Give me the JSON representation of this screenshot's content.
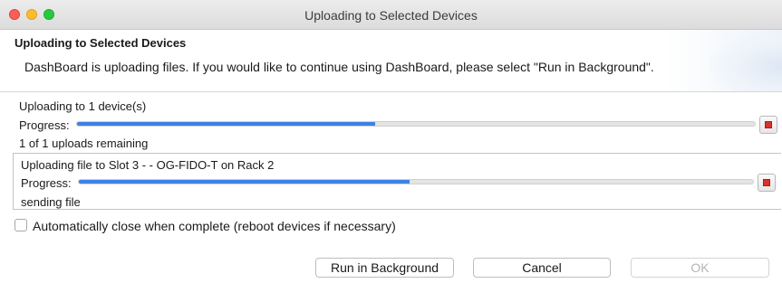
{
  "window": {
    "title": "Uploading to Selected Devices"
  },
  "header": {
    "title": "Uploading to Selected Devices",
    "description": "DashBoard is uploading files.  If you would like to continue using DashBoard, please select \"Run in Background\"."
  },
  "overall": {
    "status": "Uploading to 1 device(s)",
    "progress_label": "Progress:",
    "progress_fraction": 0.44,
    "remaining": "1 of 1 uploads remaining"
  },
  "detail": {
    "status": "Uploading file to Slot 3 -  - OG-FIDO-T on Rack 2",
    "progress_label": "Progress:",
    "progress_fraction": 0.49,
    "state": "sending file"
  },
  "options": {
    "auto_close_label": "Automatically close when complete (reboot devices if necessary)",
    "auto_close_checked": false
  },
  "buttons": {
    "run_in_background": "Run in Background",
    "cancel": "Cancel",
    "ok": "OK",
    "ok_enabled": false
  },
  "colors": {
    "progress_fill": "#3b82e6",
    "stop_icon": "#d9312b"
  }
}
